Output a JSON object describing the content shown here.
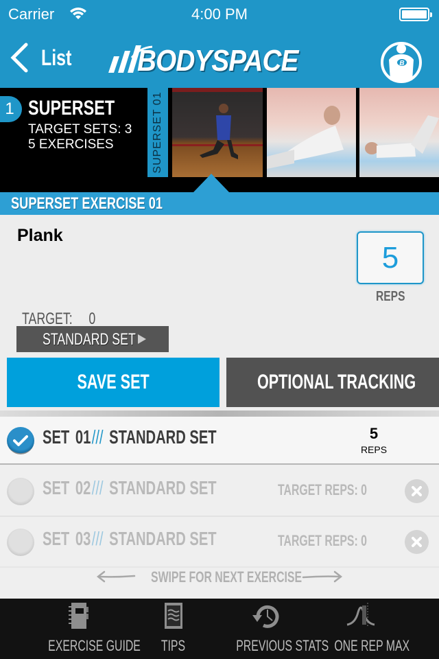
{
  "status_bar": {
    "carrier": "Carrier",
    "time": "4:00 PM"
  },
  "nav": {
    "back_label": "List",
    "logo_text": "BODYSPACE",
    "profile_icon": "bodybuilding-profile-icon"
  },
  "superset": {
    "number": "1",
    "title": "SUPERSET",
    "target_sets": "TARGET SETS: 3",
    "exercise_count": "5 EXERCISES",
    "vertical_tab": "SUPERSET 01",
    "thumbnails": [
      {
        "name": "kneeling-exercise-thumbnail",
        "active": true
      },
      {
        "name": "side-plank-thumbnail",
        "active": false
      },
      {
        "name": "crunch-thumbnail",
        "active": false
      }
    ]
  },
  "section": {
    "header": "SUPERSET EXERCISE 01"
  },
  "exercise": {
    "name": "Plank",
    "reps_value": "5",
    "reps_label": "REPS",
    "target_label": "TARGET:",
    "target_value": "0",
    "set_type": "STANDARD SET"
  },
  "actions": {
    "save_set": "SAVE SET",
    "optional_tracking": "OPTIONAL TRACKING"
  },
  "sets": [
    {
      "prefix": "SET",
      "number": "01",
      "separator": "///",
      "type": "STANDARD SET",
      "completed": true,
      "reps": "5",
      "reps_label": "REPS"
    },
    {
      "prefix": "SET",
      "number": "02",
      "separator": "///",
      "type": "STANDARD SET",
      "completed": false,
      "target_reps": "TARGET REPS: 0"
    },
    {
      "prefix": "SET",
      "number": "03",
      "separator": "///",
      "type": "STANDARD SET",
      "completed": false,
      "target_reps": "TARGET REPS: 0"
    }
  ],
  "swipe_hint": "SWIPE FOR NEXT EXERCISE",
  "tabbar": {
    "items": [
      {
        "label": "EXERCISE GUIDE",
        "icon": "notebook-icon"
      },
      {
        "label": "TIPS",
        "icon": "notes-icon"
      },
      {
        "label": "PREVIOUS STATS",
        "icon": "history-clock-icon"
      },
      {
        "label": "ONE REP MAX",
        "icon": "bell-curve-icon"
      }
    ]
  },
  "colors": {
    "brand_blue": "#1f96c8",
    "save_button": "#00a0dc",
    "dark_button": "#525252",
    "tab_bar": "#121212"
  }
}
